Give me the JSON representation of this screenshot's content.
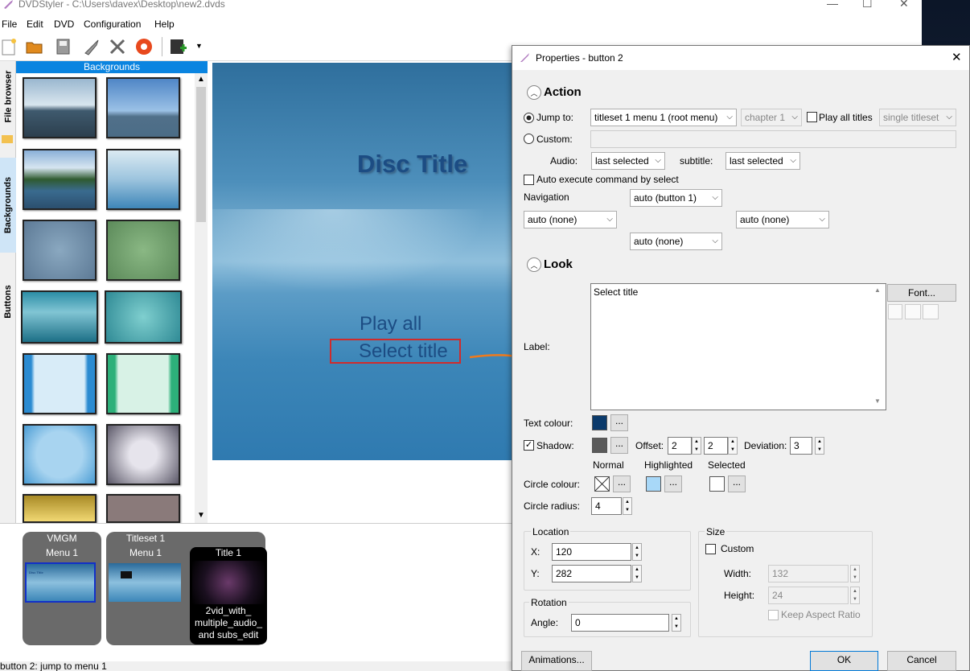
{
  "window": {
    "title": "DVDStyler - C:\\Users\\davex\\Desktop\\new2.dvds",
    "controls": [
      "—",
      "☐",
      "✕"
    ]
  },
  "menubar": [
    "File",
    "Edit",
    "DVD",
    "Configuration",
    "Help"
  ],
  "toolbar_icons": [
    "new-icon",
    "open-icon",
    "save-icon",
    "burn-icon",
    "settings-icon",
    "disc-icon",
    "add-video-icon"
  ],
  "side_tabs": [
    "File browser",
    "Backgrounds",
    "Buttons"
  ],
  "backgrounds_panel": {
    "title": "Backgrounds"
  },
  "canvas": {
    "disc_title": "Disc Title",
    "button_play_all": "Play all",
    "button_select_title": "Select title"
  },
  "titlesets": {
    "vmgm_label": "VMGM",
    "vmgm_menu": "Menu 1",
    "titleset_label": "Titleset 1",
    "titleset_menu": "Menu 1",
    "title_label": "Title 1",
    "title_file": "2vid_with_ multiple_audio_ and subs_edit",
    "mini_disc_title": "Disc Title"
  },
  "status": "button 2: jump to menu 1",
  "dialog": {
    "title": "Properties - button 2",
    "action": {
      "heading": "Action",
      "jump_to_label": "Jump to:",
      "jump_to_value": "titleset 1 menu 1 (root menu)",
      "chapter_value": "chapter 1",
      "play_all_titles": "Play all titles",
      "single_titleset": "single titleset",
      "custom_label": "Custom:",
      "custom_value": "",
      "audio_label": "Audio:",
      "audio_value": "last selected",
      "subtitle_label": "subtitle:",
      "subtitle_value": "last selected",
      "auto_execute": "Auto execute command by select",
      "navigation_label": "Navigation",
      "nav_up": "auto (button 1)",
      "nav_left": "auto (none)",
      "nav_right": "auto (none)",
      "nav_down": "auto (none)"
    },
    "look": {
      "heading": "Look",
      "label_label": "Label:",
      "label_value": "Select title",
      "font_button": "Font...",
      "text_colour_label": "Text colour:",
      "text_colour": "#0b3a6b",
      "shadow_label": "Shadow:",
      "shadow_colour": "#5a5a5a",
      "offset_label": "Offset:",
      "offset_x": "2",
      "offset_y": "2",
      "deviation_label": "Deviation:",
      "deviation": "3",
      "col_normal": "Normal",
      "col_highlighted": "Highlighted",
      "col_selected": "Selected",
      "circle_colour_label": "Circle colour:",
      "highlighted_colour": "#a8d8f8",
      "selected_colour": "#ffffff",
      "circle_radius_label": "Circle radius:",
      "circle_radius": "4",
      "ellipsis": "..."
    },
    "location": {
      "heading": "Location",
      "x_label": "X:",
      "x": "120",
      "y_label": "Y:",
      "y": "282"
    },
    "size": {
      "heading": "Size",
      "custom": "Custom",
      "width_label": "Width:",
      "width": "132",
      "height_label": "Height:",
      "height": "24",
      "keep_aspect": "Keep Aspect Ratio"
    },
    "rotation": {
      "heading": "Rotation",
      "angle_label": "Angle:",
      "angle": "0"
    },
    "buttons": {
      "animations": "Animations...",
      "ok": "OK",
      "cancel": "Cancel"
    }
  }
}
